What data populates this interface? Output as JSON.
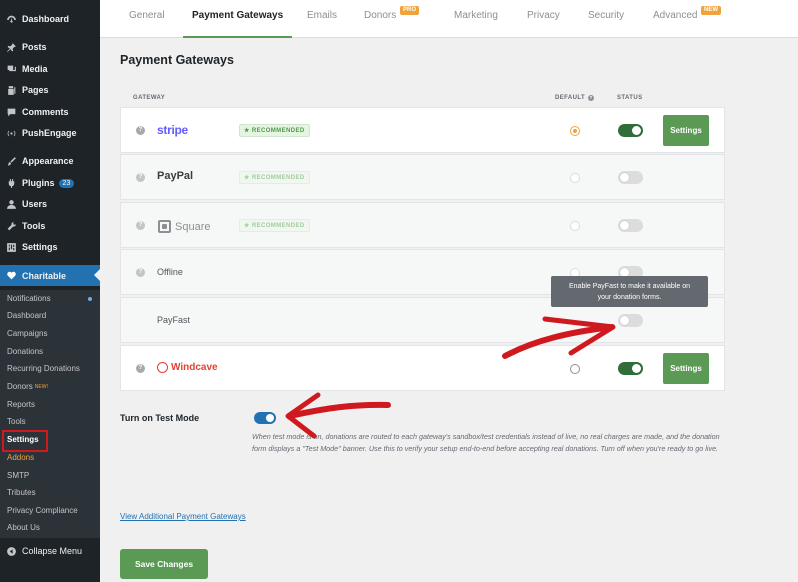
{
  "sidebar": {
    "menu": [
      {
        "label": "Dashboard",
        "icon": "dashboard-icon"
      },
      {
        "label": "Posts",
        "icon": "pin-icon"
      },
      {
        "label": "Media",
        "icon": "media-icon"
      },
      {
        "label": "Pages",
        "icon": "pages-icon"
      },
      {
        "label": "Comments",
        "icon": "comments-icon"
      },
      {
        "label": "PushEngage",
        "icon": "broadcast-icon"
      },
      {
        "label": "Appearance",
        "icon": "brush-icon"
      },
      {
        "label": "Plugins",
        "icon": "plug-icon",
        "badge": "23"
      },
      {
        "label": "Users",
        "icon": "user-icon"
      },
      {
        "label": "Tools",
        "icon": "wrench-icon"
      },
      {
        "label": "Settings",
        "icon": "settings-icon"
      },
      {
        "label": "Charitable",
        "icon": "heart-icon"
      }
    ],
    "submenu": [
      "Notifications",
      "Dashboard",
      "Campaigns",
      "Donations",
      "Recurring Donations",
      "Donors",
      "Reports",
      "Tools",
      "Settings",
      "Addons",
      "SMTP",
      "Tributes",
      "Privacy Compliance",
      "About Us"
    ],
    "donors_new": "NEW!",
    "collapse_label": "Collapse Menu"
  },
  "tabs": [
    {
      "label": "General"
    },
    {
      "label": "Payment Gateways"
    },
    {
      "label": "Emails"
    },
    {
      "label": "Donors",
      "pill": "PRO"
    },
    {
      "label": "Marketing"
    },
    {
      "label": "Privacy"
    },
    {
      "label": "Security"
    },
    {
      "label": "Advanced",
      "pill": "NEW"
    }
  ],
  "page_title": "Payment Gateways",
  "columns": {
    "gateway": "GATEWAY",
    "default": "DEFAULT",
    "status": "STATUS"
  },
  "gateways": [
    {
      "name": "stripe",
      "recommended": "★ RECOMMENDED",
      "default": true,
      "status": "on",
      "settings": "Settings"
    },
    {
      "name": "PayPal",
      "recommended": "★ RECOMMENDED",
      "default": false,
      "status": "off"
    },
    {
      "name": "Square",
      "recommended": "★ RECOMMENDED",
      "default": false,
      "status": "off"
    },
    {
      "name": "Offline",
      "default": false,
      "status": "off"
    },
    {
      "name": "PayFast",
      "status": "off"
    },
    {
      "name": "Windcave",
      "default": false,
      "status": "on",
      "settings": "Settings"
    }
  ],
  "tooltip": {
    "line1": "Enable PayFast to make it available on",
    "line2": "your donation forms."
  },
  "test_mode": {
    "label": "Turn on Test Mode",
    "enabled": true,
    "description": "When test mode is on, donations are routed to each gateway's sandbox/test credentials instead of live, no real charges are made, and the donation form displays a \"Test Mode\" banner. Use this to verify your setup end-to-end before accepting real donations. Turn off when you're ready to go live."
  },
  "view_link": "View Additional Payment Gateways",
  "save_label": "Save Changes",
  "colors": {
    "accent_green": "#5a9a54",
    "wp_blue": "#2271b1",
    "annotation_red": "#d0191e"
  }
}
